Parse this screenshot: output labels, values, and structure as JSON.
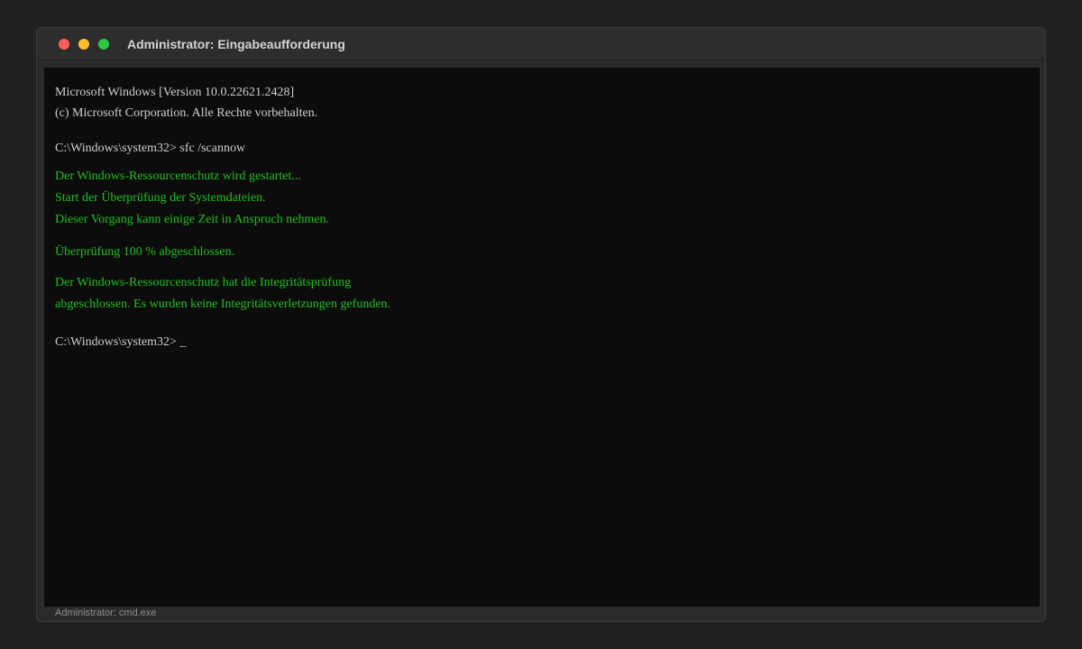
{
  "window": {
    "title": "Administrator: Eingabeaufforderung",
    "status": "Administrator: cmd.exe"
  },
  "terminal": {
    "lines": [
      "Microsoft Windows [Version 10.0.22621.2428]",
      "(c) Microsoft Corporation. Alle Rechte vorbehalten.",
      "C:\\Windows\\system32> sfc /scannow",
      "Der Windows-Ressourcenschutz wird gestartet...",
      "Start der Überprüfung der Systemdateien.",
      "Dieser Vorgang kann einige Zeit in Anspruch nehmen.",
      "Überprüfung 100 % abgeschlossen.",
      "Der Windows-Ressourcenschutz hat die Integritätsprüfung",
      "abgeschlossen. Es wurden keine Integritätsverletzungen gefunden.",
      "C:\\Windows\\system32> _"
    ]
  },
  "colors": {
    "background": "#212121",
    "terminal_bg": "#0c0c0c",
    "text_white": "#cfcfcf",
    "text_green": "#1fc01f",
    "close": "#ff5f57",
    "minimize": "#febc2e",
    "maximize": "#28c840"
  }
}
